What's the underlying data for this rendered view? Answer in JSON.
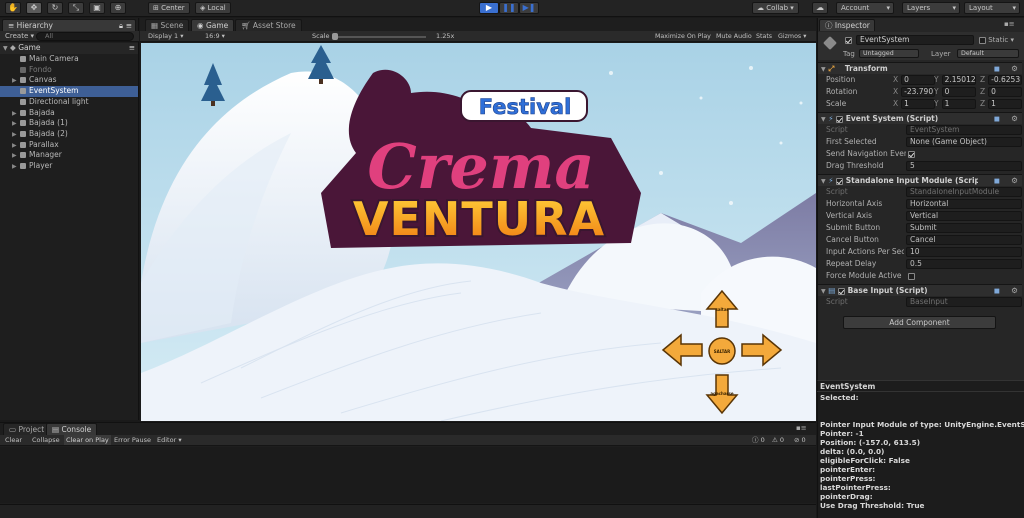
{
  "toolbar": {
    "center_label": "Center",
    "local_label": "Local",
    "collab_label": "Collab",
    "account_label": "Account",
    "layers_label": "Layers",
    "layout_label": "Layout"
  },
  "hierarchy": {
    "tab_label": "Hierarchy",
    "create_label": "Create",
    "search_placeholder": "All",
    "scene_name": "Game",
    "items": [
      {
        "label": "Main Camera",
        "expandable": false,
        "selected": false
      },
      {
        "label": "Fondo",
        "expandable": false,
        "selected": false,
        "dim": true
      },
      {
        "label": "Canvas",
        "expandable": true,
        "selected": false
      },
      {
        "label": "EventSystem",
        "expandable": false,
        "selected": true
      },
      {
        "label": "Directional light",
        "expandable": false,
        "selected": false
      },
      {
        "label": "Bajada",
        "expandable": true,
        "selected": false
      },
      {
        "label": "Bajada (1)",
        "expandable": true,
        "selected": false
      },
      {
        "label": "Bajada (2)",
        "expandable": true,
        "selected": false
      },
      {
        "label": "Parallax",
        "expandable": true,
        "selected": false
      },
      {
        "label": "Manager",
        "expandable": true,
        "selected": false
      },
      {
        "label": "Player",
        "expandable": true,
        "selected": false
      }
    ]
  },
  "game_view": {
    "tabs": [
      "Scene",
      "Game",
      "Asset Store"
    ],
    "active_tab": "Game",
    "display_label": "Display 1",
    "aspect_label": "16:9",
    "scale_label": "Scale",
    "scale_value": "1.25x",
    "options": [
      "Maximize On Play",
      "Mute Audio",
      "Stats",
      "Gizmos"
    ],
    "logo_top": "Festival",
    "logo_mid": "Crema",
    "logo_bottom": "VENTURA",
    "dpad": {
      "up": "saltar",
      "left": "",
      "right": "",
      "down": "agacharse",
      "center": "SALTAR"
    }
  },
  "inspector": {
    "tab_label": "Inspector",
    "object_name": "EventSystem",
    "static_label": "Static",
    "tag_label": "Tag",
    "tag_value": "Untagged",
    "layer_label": "Layer",
    "layer_value": "Default",
    "transform": {
      "title": "Transform",
      "position_label": "Position",
      "rotation_label": "Rotation",
      "scale_label": "Scale",
      "position": [
        "0",
        "2.150129",
        "-0.6253"
      ],
      "rotation": [
        "-23.790",
        "0",
        "0"
      ],
      "scale": [
        "1",
        "1",
        "1"
      ]
    },
    "event_system": {
      "title": "Event System (Script)",
      "script_label": "Script",
      "script_value": "EventSystem",
      "first_selected_label": "First Selected",
      "first_selected_value": "None (Game Object)",
      "send_nav_label": "Send Navigation Events",
      "drag_threshold_label": "Drag Threshold",
      "drag_threshold_value": "5"
    },
    "standalone": {
      "title": "Standalone Input Module (Script)",
      "script_label": "Script",
      "script_value": "StandaloneInputModule",
      "horizontal_label": "Horizontal Axis",
      "horizontal_value": "Horizontal",
      "vertical_label": "Vertical Axis",
      "vertical_value": "Vertical",
      "submit_label": "Submit Button",
      "submit_value": "Submit",
      "cancel_label": "Cancel Button",
      "cancel_value": "Cancel",
      "input_actions_label": "Input Actions Per Second",
      "input_actions_value": "10",
      "repeat_delay_label": "Repeat Delay",
      "repeat_delay_value": "0.5",
      "force_active_label": "Force Module Active"
    },
    "base_input": {
      "title": "Base Input (Script)",
      "script_label": "Script",
      "script_value": "BaseInput"
    },
    "add_component_label": "Add Component"
  },
  "event_panel": {
    "title": "EventSystem",
    "lines": [
      "Selected:",
      "",
      "",
      "Pointer Input Module of type: UnityEngine.EventSystems.StandaloneInputModule",
      "Pointer: -1",
      "Position: (-157.0, 613.5)",
      "delta: (0.0, 0.0)",
      "eligibleForClick: False",
      "pointerEnter:",
      "pointerPress:",
      "lastPointerPress:",
      "pointerDrag:",
      "Use Drag Threshold: True"
    ]
  },
  "console": {
    "tabs": [
      "Project",
      "Console"
    ],
    "active_tab": "Console",
    "buttons": [
      "Clear",
      "Collapse",
      "Clear on Play",
      "Error Pause",
      "Editor"
    ],
    "count_info": "0",
    "count_warn": "0",
    "count_error": "0"
  },
  "colors": {
    "selection": "#3e5f96",
    "play_active": "#3a6fd0",
    "logo_pink": "#e0407e",
    "logo_orange": "#f39a1e",
    "dpad_orange": "#f3a93b"
  }
}
